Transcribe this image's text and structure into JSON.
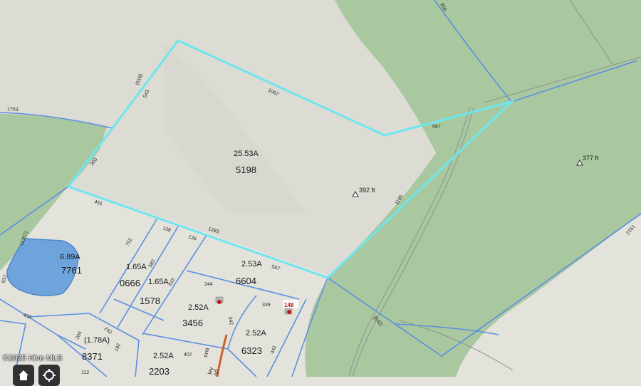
{
  "map": {
    "colors": {
      "background": "#e3e3dc",
      "vegetation": "#a9c8a0",
      "water": "#6fa3dc",
      "subject_parcel": "#6ee6f0",
      "parcel_lines": "#5b8fe0",
      "road_line": "#c8642a"
    },
    "subject_parcel": {
      "acreage": "25.53A",
      "parcel_id": "5198"
    },
    "elevations": [
      {
        "label": "392 ft",
        "icon": "triangle-marker-icon"
      },
      {
        "label": "377 ft",
        "icon": "triangle-marker-icon"
      }
    ],
    "parcels": [
      {
        "acreage": "6.89A",
        "parcel_id": "7761"
      },
      {
        "acreage": "1.65A",
        "parcel_id": "0666"
      },
      {
        "acreage": "1.65A",
        "parcel_id": "1578"
      },
      {
        "acreage": "2.53A",
        "parcel_id": "6604"
      },
      {
        "acreage": "2.52A",
        "parcel_id": "3456"
      },
      {
        "acreage": "2.52A",
        "parcel_id": "6323"
      },
      {
        "acreage": "(1.78A)",
        "parcel_id": "8371"
      },
      {
        "acreage": "2.52A",
        "parcel_id": "2203"
      }
    ],
    "dimensions": [
      "1067",
      "(618)",
      "543",
      "303",
      "1763",
      "597",
      "1185",
      "451",
      "1283",
      "752",
      "138",
      "126",
      "583",
      "615",
      "567",
      "244",
      "339",
      "342",
      "(1357)",
      "637",
      "433",
      "204",
      "242",
      "192",
      "407",
      "441",
      "112",
      "(642)",
      "2161",
      "856"
    ],
    "lot_marker": {
      "label": "148"
    },
    "road_names": [
      "nna",
      "ley",
      "nd"
    ],
    "credit": "©2025 Hive MLS",
    "controls": [
      {
        "name": "home",
        "icon": "home-icon"
      },
      {
        "name": "locate",
        "icon": "locate-icon"
      }
    ]
  }
}
